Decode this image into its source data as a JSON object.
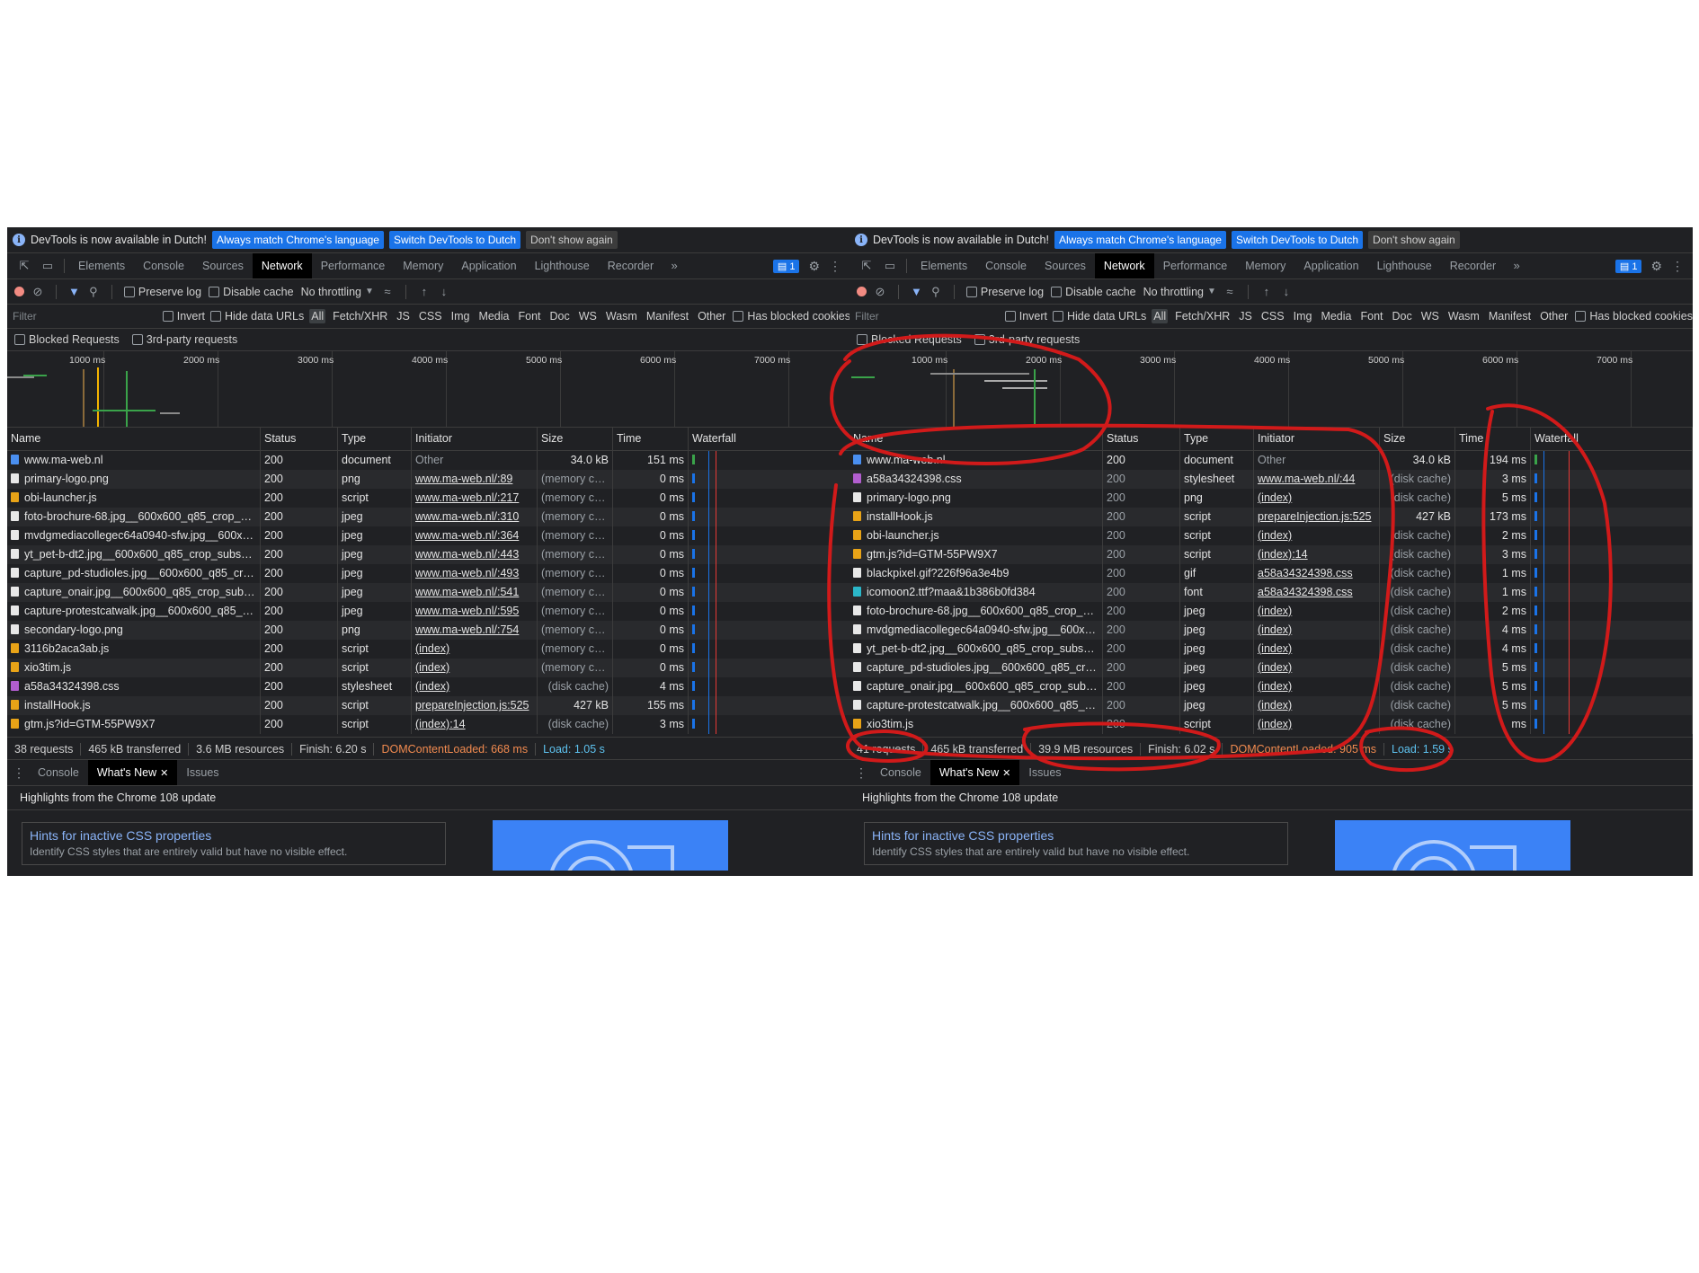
{
  "infobar": {
    "message": "DevTools is now available in Dutch!",
    "btn_match": "Always match Chrome's language",
    "btn_switch": "Switch DevTools to Dutch",
    "btn_dismiss": "Don't show again"
  },
  "tabs": [
    "Elements",
    "Console",
    "Sources",
    "Network",
    "Performance",
    "Memory",
    "Application",
    "Lighthouse",
    "Recorder"
  ],
  "active_tab": "Network",
  "issues_count": "1",
  "toolbar": {
    "preserve_log": "Preserve log",
    "disable_cache": "Disable cache",
    "throttling": "No throttling"
  },
  "filter": {
    "placeholder": "Filter",
    "invert": "Invert",
    "hide_data_urls": "Hide data URLs",
    "types": [
      "All",
      "Fetch/XHR",
      "JS",
      "CSS",
      "Img",
      "Media",
      "Font",
      "Doc",
      "WS",
      "Wasm",
      "Manifest",
      "Other"
    ],
    "blocked_cookies": "Has blocked cookies",
    "blocked_requests": "Blocked Requests",
    "third_party": "3rd-party requests"
  },
  "timeline_ticks": [
    "1000 ms",
    "2000 ms",
    "3000 ms",
    "4000 ms",
    "5000 ms",
    "6000 ms",
    "7000 ms"
  ],
  "columns": {
    "name": "Name",
    "status": "Status",
    "type": "Type",
    "initiator": "Initiator",
    "size": "Size",
    "time": "Time",
    "waterfall": "Waterfall"
  },
  "left": {
    "rows": [
      {
        "name": "www.ma-web.nl",
        "status": "200",
        "type": "document",
        "initiator": "Other",
        "size": "34.0 kB",
        "time": "151 ms",
        "icon": "doc"
      },
      {
        "name": "primary-logo.png",
        "status": "200",
        "type": "png",
        "initiator": "www.ma-web.nl/:89",
        "size": "(memory ca...",
        "time": "0 ms",
        "icon": "img"
      },
      {
        "name": "obi-launcher.js",
        "status": "200",
        "type": "script",
        "initiator": "www.ma-web.nl/:217",
        "size": "(memory ca...",
        "time": "0 ms",
        "icon": "script"
      },
      {
        "name": "foto-brochure-68.jpg__600x600_q85_crop_su...",
        "status": "200",
        "type": "jpeg",
        "initiator": "www.ma-web.nl/:310",
        "size": "(memory ca...",
        "time": "0 ms",
        "icon": "img"
      },
      {
        "name": "mvdgmediacollegec64a0940-sfw.jpg__600x6...",
        "status": "200",
        "type": "jpeg",
        "initiator": "www.ma-web.nl/:364",
        "size": "(memory ca...",
        "time": "0 ms",
        "icon": "img"
      },
      {
        "name": "yt_pet-b-dt2.jpg__600x600_q85_crop_subsa...",
        "status": "200",
        "type": "jpeg",
        "initiator": "www.ma-web.nl/:443",
        "size": "(memory ca...",
        "time": "0 ms",
        "icon": "img"
      },
      {
        "name": "capture_pd-studioles.jpg__600x600_q85_cro...",
        "status": "200",
        "type": "jpeg",
        "initiator": "www.ma-web.nl/:493",
        "size": "(memory ca...",
        "time": "0 ms",
        "icon": "img"
      },
      {
        "name": "capture_onair.jpg__600x600_q85_crop_subsa...",
        "status": "200",
        "type": "jpeg",
        "initiator": "www.ma-web.nl/:541",
        "size": "(memory ca...",
        "time": "0 ms",
        "icon": "img"
      },
      {
        "name": "capture-protestcatwalk.jpg__600x600_q85_cr...",
        "status": "200",
        "type": "jpeg",
        "initiator": "www.ma-web.nl/:595",
        "size": "(memory ca...",
        "time": "0 ms",
        "icon": "img"
      },
      {
        "name": "secondary-logo.png",
        "status": "200",
        "type": "png",
        "initiator": "www.ma-web.nl/:754",
        "size": "(memory ca...",
        "time": "0 ms",
        "icon": "img"
      },
      {
        "name": "3116b2aca3ab.js",
        "status": "200",
        "type": "script",
        "initiator": "(index)",
        "size": "(memory ca...",
        "time": "0 ms",
        "icon": "script"
      },
      {
        "name": "xio3tim.js",
        "status": "200",
        "type": "script",
        "initiator": "(index)",
        "size": "(memory ca...",
        "time": "0 ms",
        "icon": "script"
      },
      {
        "name": "a58a34324398.css",
        "status": "200",
        "type": "stylesheet",
        "initiator": "(index)",
        "size": "(disk cache)",
        "time": "4 ms",
        "icon": "css"
      },
      {
        "name": "installHook.js",
        "status": "200",
        "type": "script",
        "initiator": "prepareInjection.js:525",
        "size": "427 kB",
        "time": "155 ms",
        "icon": "script"
      },
      {
        "name": "gtm.js?id=GTM-55PW9X7",
        "status": "200",
        "type": "script",
        "initiator": "(index):14",
        "size": "(disk cache)",
        "time": "3 ms",
        "icon": "script"
      }
    ],
    "status": {
      "requests": "38 requests",
      "transferred": "465 kB transferred",
      "resources": "3.6 MB resources",
      "finish": "Finish: 6.20 s",
      "dcl": "DOMContentLoaded: 668 ms",
      "load": "Load: 1.05 s"
    }
  },
  "right": {
    "rows": [
      {
        "name": "www.ma-web.nl",
        "status": "200",
        "type": "document",
        "initiator": "Other",
        "size": "34.0 kB",
        "time": "194 ms",
        "icon": "doc"
      },
      {
        "name": "a58a34324398.css",
        "status": "200",
        "type": "stylesheet",
        "initiator": "www.ma-web.nl/:44",
        "size": "(disk cache)",
        "time": "3 ms",
        "icon": "css"
      },
      {
        "name": "primary-logo.png",
        "status": "200",
        "type": "png",
        "initiator": "(index)",
        "size": "(disk cache)",
        "time": "5 ms",
        "icon": "img"
      },
      {
        "name": "installHook.js",
        "status": "200",
        "type": "script",
        "initiator": "prepareInjection.js:525",
        "size": "427 kB",
        "time": "173 ms",
        "icon": "script"
      },
      {
        "name": "obi-launcher.js",
        "status": "200",
        "type": "script",
        "initiator": "(index)",
        "size": "(disk cache)",
        "time": "2 ms",
        "icon": "script"
      },
      {
        "name": "gtm.js?id=GTM-55PW9X7",
        "status": "200",
        "type": "script",
        "initiator": "(index):14",
        "size": "(disk cache)",
        "time": "3 ms",
        "icon": "script"
      },
      {
        "name": "blackpixel.gif?226f96a3e4b9",
        "status": "200",
        "type": "gif",
        "initiator": "a58a34324398.css",
        "size": "(disk cache)",
        "time": "1 ms",
        "icon": "img"
      },
      {
        "name": "icomoon2.ttf?maa&1b386b0fd384",
        "status": "200",
        "type": "font",
        "initiator": "a58a34324398.css",
        "size": "(disk cache)",
        "time": "1 ms",
        "icon": "font"
      },
      {
        "name": "foto-brochure-68.jpg__600x600_q85_crop_su...",
        "status": "200",
        "type": "jpeg",
        "initiator": "(index)",
        "size": "(disk cache)",
        "time": "2 ms",
        "icon": "img"
      },
      {
        "name": "mvdgmediacollegec64a0940-sfw.jpg__600x6...",
        "status": "200",
        "type": "jpeg",
        "initiator": "(index)",
        "size": "(disk cache)",
        "time": "4 ms",
        "icon": "img"
      },
      {
        "name": "yt_pet-b-dt2.jpg__600x600_q85_crop_subsa...",
        "status": "200",
        "type": "jpeg",
        "initiator": "(index)",
        "size": "(disk cache)",
        "time": "4 ms",
        "icon": "img"
      },
      {
        "name": "capture_pd-studioles.jpg__600x600_q85_cro...",
        "status": "200",
        "type": "jpeg",
        "initiator": "(index)",
        "size": "(disk cache)",
        "time": "5 ms",
        "icon": "img"
      },
      {
        "name": "capture_onair.jpg__600x600_q85_crop_subsa...",
        "status": "200",
        "type": "jpeg",
        "initiator": "(index)",
        "size": "(disk cache)",
        "time": "5 ms",
        "icon": "img"
      },
      {
        "name": "capture-protestcatwalk.jpg__600x600_q85_cr...",
        "status": "200",
        "type": "jpeg",
        "initiator": "(index)",
        "size": "(disk cache)",
        "time": "5 ms",
        "icon": "img"
      },
      {
        "name": "xio3tim.js",
        "status": "200",
        "type": "script",
        "initiator": "(index)",
        "size": "(disk cache)",
        "time": "ms",
        "icon": "script"
      }
    ],
    "status": {
      "requests": "41 requests",
      "transferred": "465 kB transferred",
      "resources": "39.9 MB resources",
      "finish": "Finish: 6.02 s",
      "dcl": "DOMContentLoaded: 905 ms",
      "load": "Load: 1.59 s"
    }
  },
  "drawer": {
    "tabs": [
      "Console",
      "What's New",
      "Issues"
    ],
    "active": "What's New",
    "highlights": "Highlights from the Chrome 108 update",
    "card_title": "Hints for inactive CSS properties",
    "card_desc": "Identify CSS styles that are entirely valid but have no visible effect."
  },
  "colors": {
    "annotation": "#d11a1a",
    "accent": "#1a73e8",
    "background": "#202124"
  }
}
